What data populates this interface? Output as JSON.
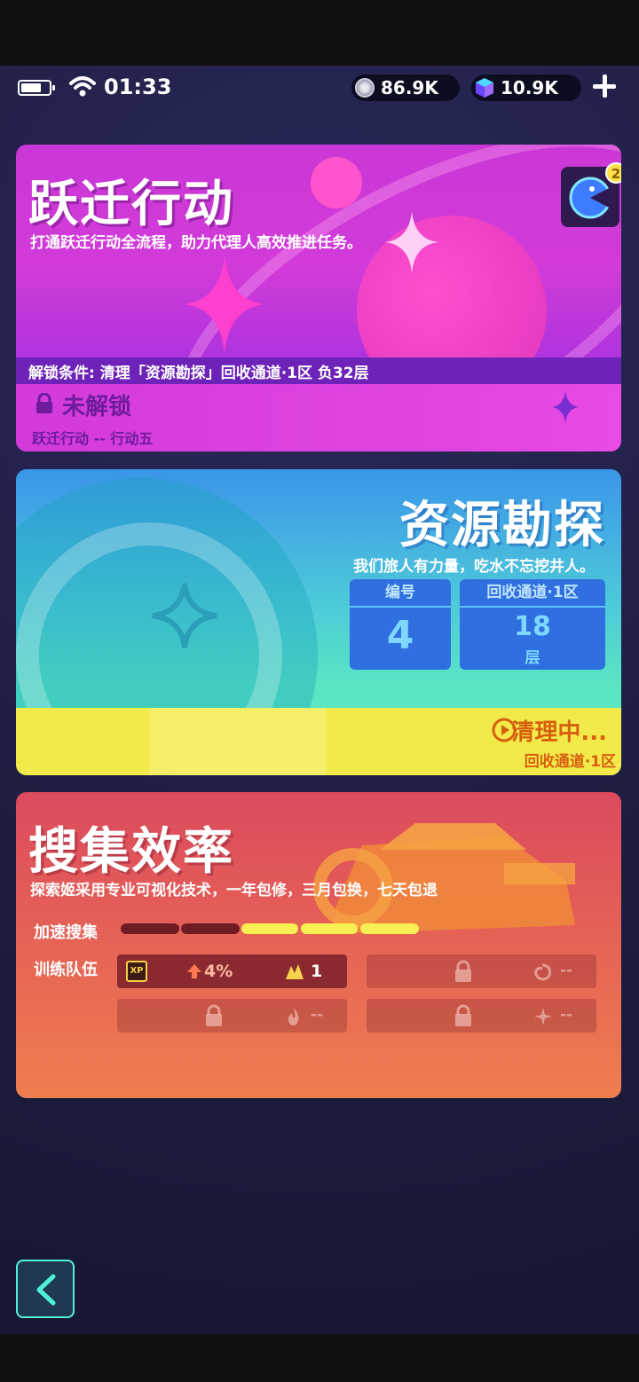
{
  "status_bar": {
    "time": "01:33",
    "coins": "86.9K",
    "gems": "10.9K"
  },
  "card_yueqian": {
    "title": "跃迁行动",
    "subtitle": "打通跃迁行动全流程，助力代理人高效推进任务。",
    "unlock_condition": "解锁条件: 清理「资源勘探」回收通道·1区 负32层",
    "status": "未解锁",
    "action_label": "跃迁行动 -- 行动五",
    "badge_count": "2",
    "accent": "#d23bd9"
  },
  "card_ziyuan": {
    "title": "资源勘探",
    "subtitle": "我们旅人有力量，吃水不忘挖井人。",
    "number_label": "编号",
    "number_value": "4",
    "zone_label": "回收通道·1区",
    "floor_value": "18",
    "floor_unit": "层",
    "cleaning_status": "清理中...",
    "cleaning_zone": "回收通道·1区",
    "accent": "#4ecbd9"
  },
  "card_soujie": {
    "title": "搜集效率",
    "subtitle": "探索姬采用专业可视化技术，一年包修，三月包换，七天包退",
    "speed_label": "加速搜集",
    "speed_level": "3/5",
    "team_label": "训练队伍",
    "slot1_rate": "4%",
    "slot1_level": "1",
    "empty_value": "--",
    "accent": "#e45e57"
  },
  "icons": [
    "battery-icon",
    "wifi-icon",
    "coin-icon",
    "gem-icon",
    "plus-icon",
    "lock-icon",
    "pacman-icon",
    "play-icon",
    "xp-icon",
    "arrow-up-icon",
    "flame-icon",
    "swirl-icon",
    "spark-icon",
    "back-chevron-icon"
  ]
}
